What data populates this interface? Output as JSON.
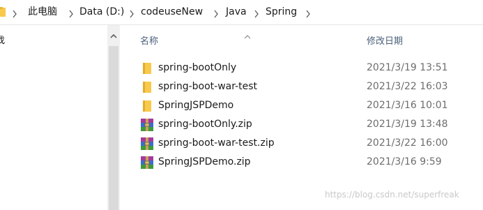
{
  "address_bar": {
    "breadcrumbs": [
      {
        "label": "此电脑"
      },
      {
        "label": "Data (D:)"
      },
      {
        "label": "codeuseNew"
      },
      {
        "label": "Java"
      },
      {
        "label": "Spring"
      }
    ],
    "folder_icon": "folder-icon",
    "separator_icon": "chevron-right-icon"
  },
  "nav_pane": {
    "partial_item_label": "找"
  },
  "file_list": {
    "columns": {
      "name": "名称",
      "modified": "修改日期"
    },
    "sort_column": "name",
    "sort_direction": "ascending",
    "rows": [
      {
        "name": "spring-bootOnly",
        "date": "2021/3/19 13:51",
        "type": "folder",
        "icon": "folder-icon"
      },
      {
        "name": "spring-boot-war-test",
        "date": "2021/3/22 16:03",
        "type": "folder",
        "icon": "folder-icon"
      },
      {
        "name": "SpringJSPDemo",
        "date": "2021/3/16 10:01",
        "type": "folder",
        "icon": "folder-icon"
      },
      {
        "name": "spring-bootOnly.zip",
        "date": "2021/3/19 13:48",
        "type": "zip",
        "icon": "winrar-archive-icon"
      },
      {
        "name": "spring-boot-war-test.zip",
        "date": "2021/3/22 16:00",
        "type": "zip",
        "icon": "winrar-archive-icon"
      },
      {
        "name": "SpringJSPDemo.zip",
        "date": "2021/3/16 9:59",
        "type": "zip",
        "icon": "winrar-archive-icon"
      }
    ]
  },
  "watermark": "https://blog.csdn.net/superfreak",
  "colors": {
    "folder": "#f8c94a",
    "column_header_text": "#4c607a",
    "date_text": "#6d6d6d"
  }
}
